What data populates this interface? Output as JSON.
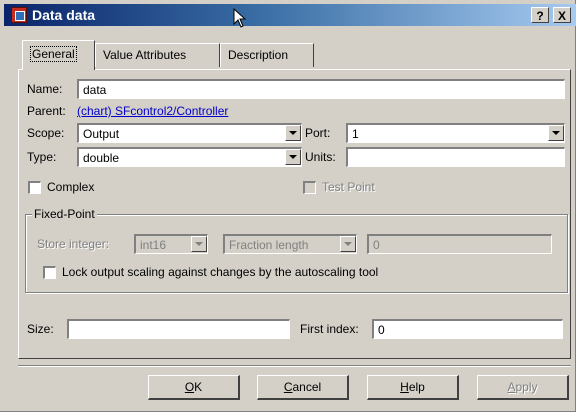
{
  "window": {
    "title": "Data data",
    "help_label": "?",
    "close_label": "X"
  },
  "tabs": [
    {
      "label": "General",
      "active": true
    },
    {
      "label": "Value Attributes",
      "active": false
    },
    {
      "label": "Description",
      "active": false
    }
  ],
  "general": {
    "name_label": "Name:",
    "name_value": "data",
    "parent_label": "Parent:",
    "parent_link": "(chart) SFcontrol2/Controller",
    "scope_label": "Scope:",
    "scope_value": "Output",
    "port_label": "Port:",
    "port_value": "1",
    "type_label": "Type:",
    "type_value": "double",
    "units_label": "Units:",
    "units_value": "",
    "complex_label": "Complex",
    "complex_checked": false,
    "test_point_label": "Test Point",
    "test_point_checked": false
  },
  "fixed_point": {
    "legend": "Fixed-Point",
    "store_integer_label": "Store integer:",
    "store_integer_value": "int16",
    "fraction_length_value": "Fraction length",
    "fraction_value": "0",
    "lock_label": "Lock output scaling against changes by the autoscaling tool",
    "lock_checked": false
  },
  "size_label": "Size:",
  "size_value": "",
  "first_index_label": "First index:",
  "first_index_value": "0",
  "buttons": {
    "ok": {
      "mnemonic": "O",
      "rest": "K"
    },
    "cancel": {
      "mnemonic": "C",
      "rest": "ancel"
    },
    "help": {
      "mnemonic": "H",
      "rest": "elp"
    },
    "apply": {
      "mnemonic": "A",
      "rest": "pply"
    }
  }
}
